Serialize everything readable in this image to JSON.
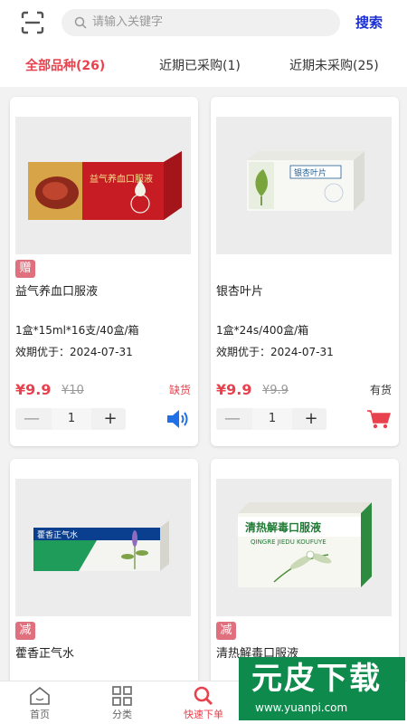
{
  "header": {
    "scan_icon": "scan-icon",
    "search_placeholder": "请输入关键字",
    "search_button": "搜索"
  },
  "tabs": [
    {
      "label": "全部品种(26)",
      "active": true
    },
    {
      "label": "近期已采购(1)",
      "active": false
    },
    {
      "label": "近期未采购(25)",
      "active": false
    }
  ],
  "products": [
    {
      "badge": "赠",
      "name": "益气养血口服液",
      "spec": "1盒*15ml*16支/40盒/箱",
      "expiry": "效期优于：2024-07-31",
      "price": "¥9.9",
      "old_price": "¥10",
      "stock": "缺货",
      "quantity": "1",
      "action_icon": "speaker-icon",
      "package_text": "益气养血口服液"
    },
    {
      "badge": "",
      "name": "银杏叶片",
      "spec": "1盒*24s/400盒/箱",
      "expiry": "效期优于：2024-07-31",
      "price": "¥9.9",
      "old_price": "¥9.9",
      "stock": "有货",
      "quantity": "1",
      "action_icon": "cart-icon",
      "package_text": "银杏叶片"
    },
    {
      "badge": "减",
      "name": "藿香正气水",
      "package_text": "藿香正气水"
    },
    {
      "badge": "减",
      "name": "清热解毒口服液",
      "package_text": "清热解毒口服液",
      "package_subtext": "QINGRE JIEDU KOUFUYE"
    }
  ],
  "steppers": {
    "minus": "—",
    "plus": "+"
  },
  "bottom_nav": [
    {
      "label": "首页",
      "icon": "home-icon",
      "active": false
    },
    {
      "label": "分类",
      "icon": "grid-icon",
      "active": false
    },
    {
      "label": "快速下单",
      "icon": "search-icon",
      "active": true
    }
  ],
  "watermark": {
    "text": "元皮下载",
    "url": "www.yuanpi.com"
  },
  "colors": {
    "accent": "#e8424f",
    "search_btn": "#1a2fd6",
    "badge": "#e0707d",
    "speaker": "#1f6fe6",
    "cart": "#e8424f"
  }
}
